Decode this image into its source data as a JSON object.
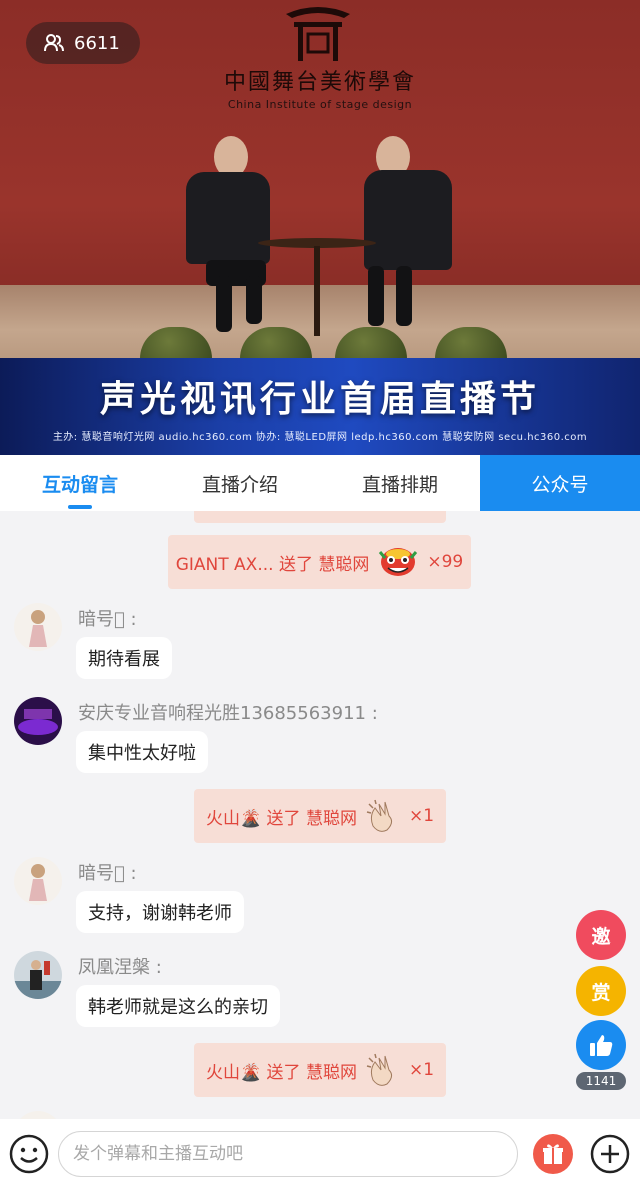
{
  "video": {
    "viewer_count": "6611",
    "logo_cn": "中國舞台美術學會",
    "logo_en": "China Institute of stage design",
    "banner_title": "声光视讯行业首届直播节",
    "banner_sponsors": "主办: 慧聪音响灯光网 audio.hc360.com   协办: 慧聪LED屏网 ledp.hc360.com   慧聪安防网 secu.hc360.com"
  },
  "tabs": [
    {
      "label": "互动留言",
      "active": true
    },
    {
      "label": "直播介绍",
      "active": false
    },
    {
      "label": "直播排期",
      "active": false
    },
    {
      "label": "公众号",
      "active": false
    }
  ],
  "chat": {
    "gift_top": {
      "text": "GIANT AX... 送了 慧聪网",
      "count": "×99",
      "icon": "lion-dance-icon"
    },
    "messages": [
      {
        "nick": "暗号\u0000 :",
        "text": "期待看展"
      },
      {
        "nick": "安庆专业音响程光胜13685563911 :",
        "text": "集中性太好啦"
      },
      {
        "nick": "暗号\u0000 :",
        "text": "支持，谢谢韩老师"
      },
      {
        "nick": "凤凰涅槃 :",
        "text": "韩老师就是这么的亲切"
      }
    ],
    "gifts": [
      {
        "text": "火山🌋 送了 慧聪网",
        "count": "×1",
        "icon": "clapping-hands-icon"
      },
      {
        "text": "火山🌋 送了 慧聪网",
        "count": "×1",
        "icon": "clapping-hands-icon"
      }
    ]
  },
  "side_buttons": {
    "invite_label": "邀",
    "reward_label": "赏",
    "like_count": "1141",
    "colors": {
      "invite": "#f04b5e",
      "reward": "#f5b400",
      "like": "#1a8cf0"
    }
  },
  "bottom": {
    "input_placeholder": "发个弹幕和主播互动吧",
    "icons": [
      "emoji-icon",
      "gift-icon",
      "plus-icon"
    ]
  },
  "colors": {
    "accent": "#1a8cf0",
    "gift_text": "#e0463c",
    "gift_bg": "#f7ded6"
  }
}
